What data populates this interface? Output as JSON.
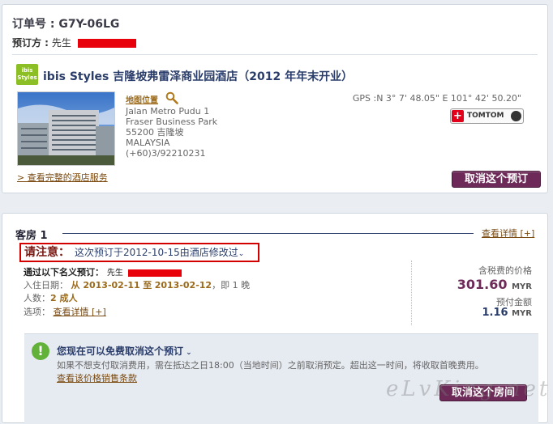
{
  "booking": {
    "order_label": "订单号 : G7Y-06LG",
    "booker_label": "预订方 :",
    "booker_title": "先生"
  },
  "hotel": {
    "logo_text": "ibis Styles",
    "name": "ibis Styles 吉隆坡弗雷泽商业园酒店（2012 年年末开业）",
    "map_link": "地图位置",
    "address_lines": [
      "Jalan Metro Pudu 1",
      "Fraser Business Park",
      "55200 吉隆坡",
      "MALAYSIA",
      "(+60)3/92210231"
    ],
    "gps": "GPS :N 3° 7' 48.05\" E 101° 42' 50.20\"",
    "tomtom_label": "TOMTOM",
    "services_link": "> 查看完整的酒店服务",
    "cancel_button": "取消这个预订"
  },
  "room": {
    "title": "客房 1",
    "details_link": "查看详情 [+]",
    "notice_label": "请注意：",
    "notice_text": "这次预订于2012-10-15由酒店修改过",
    "guest_label": "通过以下名义预订：",
    "guest_title": "先生",
    "dates_label": "入住日期：",
    "dates_from": "从 2013-02-11",
    "dates_to_word": "至",
    "dates_to": "2013-02-12",
    "dates_suffix": "，即 1 晚",
    "people_label": "人数：",
    "people_value": "2 成人",
    "options_label": "选项：",
    "options_link": "查看详情 [+]",
    "price_label": "含税费的价格",
    "price_value": "301.60",
    "currency": "MYR",
    "deposit_label": "预付金额",
    "deposit_value": "1.16"
  },
  "cancellation": {
    "title": "您现在可以免费取消这个预订",
    "body": "如果不想支付取消费用，需在抵达之日18:00（当地时间）之前取消预定。超出这一时间，将收取首晚费用。",
    "terms_link": "查看该价格销售条款",
    "cancel_room_button": "取消这个房间"
  },
  "watermark": "eLvKing.net",
  "colors": {
    "accent": "#6d2a58",
    "navy": "#2a3d6a",
    "redaction": "#e8000b",
    "check": "#62b23a"
  }
}
